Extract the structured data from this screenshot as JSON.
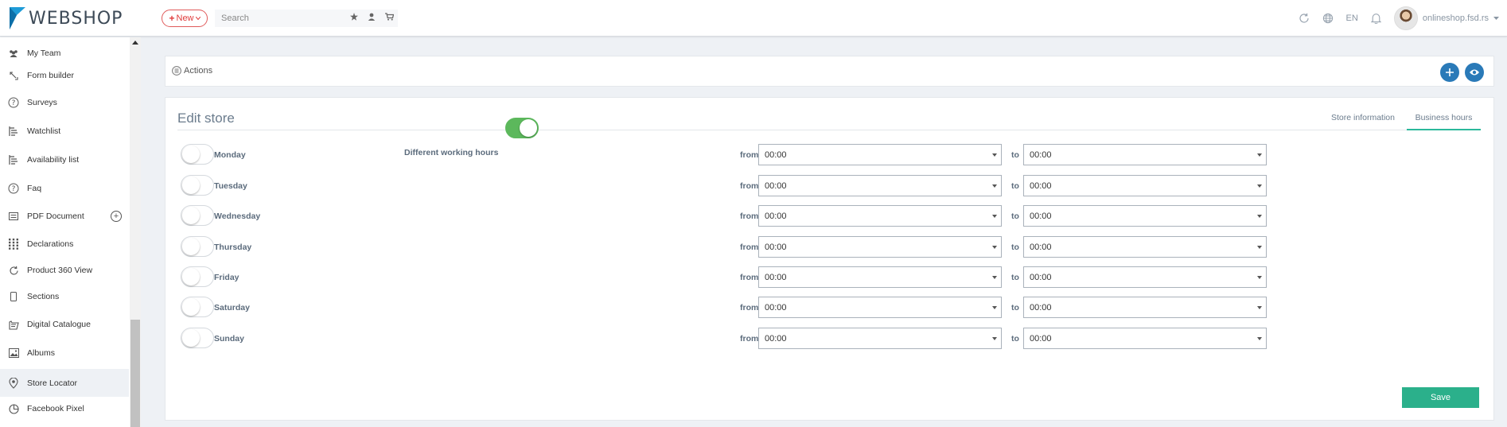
{
  "header": {
    "logo_text": "WEBSHOP",
    "new_label": "New",
    "search_placeholder": "Search",
    "language": "EN",
    "user_name": "onlineshop.fsd.rs"
  },
  "sidebar": {
    "items": [
      {
        "label": "My Team",
        "icon": "team-icon"
      },
      {
        "label": "Form builder",
        "icon": "form-builder-icon"
      },
      {
        "label": "Surveys",
        "icon": "question-circle-icon"
      },
      {
        "label": "Watchlist",
        "icon": "watchlist-icon"
      },
      {
        "label": "Availability list",
        "icon": "availability-list-icon"
      },
      {
        "label": "Faq",
        "icon": "question-circle-icon"
      },
      {
        "label": "PDF Document",
        "icon": "pdf-document-icon"
      },
      {
        "label": "Declarations",
        "icon": "grid-icon"
      },
      {
        "label": "Product 360 View",
        "icon": "rotate-icon"
      },
      {
        "label": "Sections",
        "icon": "mobile-icon"
      },
      {
        "label": "Digital Catalogue",
        "icon": "catalogue-icon"
      },
      {
        "label": "Albums",
        "icon": "image-icon"
      },
      {
        "label": "Store Locator",
        "icon": "store-locator-icon"
      },
      {
        "label": "Facebook Pixel",
        "icon": "pie-chart-icon"
      }
    ],
    "active_item": "Store Locator"
  },
  "actions": {
    "label": "Actions"
  },
  "editor": {
    "title": "Edit store",
    "tabs": [
      {
        "label": "Store information",
        "active": false
      },
      {
        "label": "Business hours",
        "active": true
      }
    ],
    "different_hours_label": "Different working hours",
    "different_hours_on": true,
    "from_label": "from",
    "to_label": "to",
    "days": [
      {
        "name": "Monday",
        "enabled": false,
        "from": "00:00",
        "to": "00:00"
      },
      {
        "name": "Tuesday",
        "enabled": false,
        "from": "00:00",
        "to": "00:00"
      },
      {
        "name": "Wednesday",
        "enabled": false,
        "from": "00:00",
        "to": "00:00"
      },
      {
        "name": "Thursday",
        "enabled": false,
        "from": "00:00",
        "to": "00:00"
      },
      {
        "name": "Friday",
        "enabled": false,
        "from": "00:00",
        "to": "00:00"
      },
      {
        "name": "Saturday",
        "enabled": false,
        "from": "00:00",
        "to": "00:00"
      },
      {
        "name": "Sunday",
        "enabled": false,
        "from": "00:00",
        "to": "00:00"
      }
    ],
    "save_label": "Save"
  },
  "colors": {
    "accent_green": "#2bb08b",
    "toggle_on": "#5cb85c",
    "action_blue": "#2a7ab8",
    "new_red": "#e03b3b"
  }
}
